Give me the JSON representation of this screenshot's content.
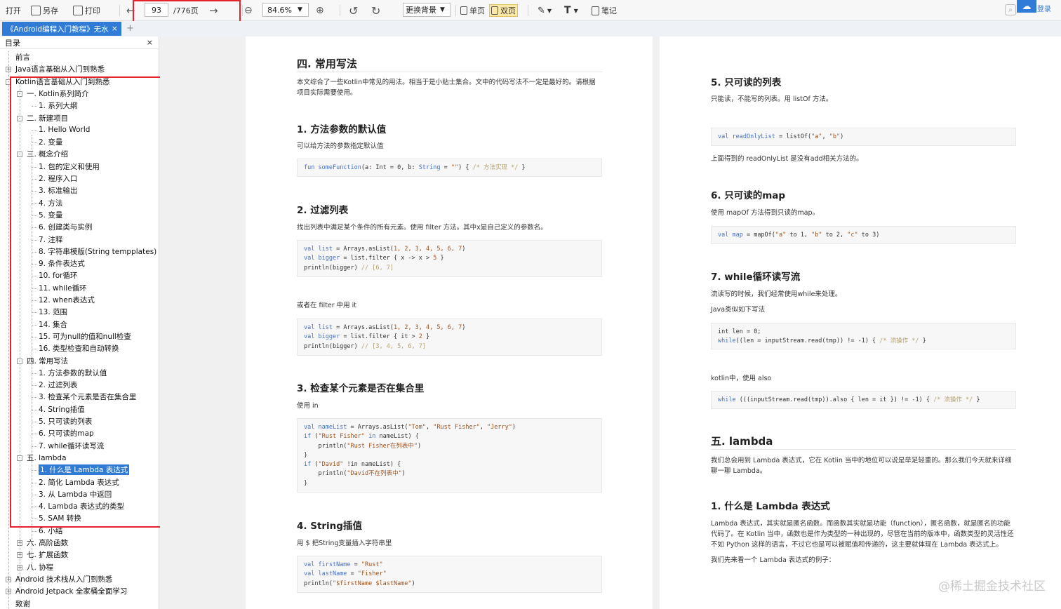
{
  "toolbar": {
    "open": "打开",
    "save_as": "另存",
    "print": "打印",
    "page_current": "93",
    "page_total": "/776页",
    "zoom": "84.6%",
    "bg": "更换背景",
    "single": "单页",
    "double": "双页",
    "notes": "笔记",
    "login": "登录"
  },
  "tab": {
    "title": "《Android编程入门教程》无水",
    "close": "×",
    "add": "+"
  },
  "sidebar": {
    "title": "目录",
    "close": "×",
    "items": [
      "前言",
      "Java语言基础从入门到熟悉",
      "Kotlin语言基础从入门到熟悉",
      "一. Kotlin系列简介",
      "1. 系列大纲",
      "二. 新建项目",
      "1. Hello World",
      "2. 变量",
      "三. 概念介绍",
      "1. 包的定义和使用",
      "2. 程序入口",
      "3. 标准输出",
      "4. 方法",
      "5. 变量",
      "6. 创建类与实例",
      "7. 注释",
      "8. 字符串模版(String tempplates)",
      "9. 条件表达式",
      "10. for循环",
      "11. while循环",
      "12. when表达式",
      "13. 范围",
      "14. 集合",
      "15. 可为null的值和null检查",
      "16. 类型检查和自动转换",
      "四. 常用写法",
      "1. 方法参数的默认值",
      "2. 过滤列表",
      "3. 检查某个元素是否在集合里",
      "4. String插值",
      "5. 只可读的列表",
      "6. 只可读的map",
      "7. while循环读写流",
      "五. lambda",
      "1. 什么是 Lambda 表达式",
      "2. 简化 Lambda 表达式",
      "3. 从 Lambda 中返回",
      "4. Lambda 表达式的类型",
      "5. SAM 转换",
      "6. 小结",
      "六. 高阶函数",
      "七. 扩展函数",
      "八. 协程",
      "Android 技术栈从入门到熟悉",
      "Android Jetpack 全家桶全面学习",
      "致谢"
    ]
  },
  "left_page": {
    "h_section": "四. 常用写法",
    "intro": "本文综合了一些Kotlin中常见的用法。相当于是小贴士集合。文中的代码写法不一定是最好的。请根据项目实际需要使用。",
    "s1_title": "1. 方法参数的默认值",
    "s1_desc": "可以给方法的参数指定默认值",
    "s2_title": "2. 过滤列表",
    "s2_desc": "找出列表中满足某个条件的所有元素。使用 filter 方法。其中x是自己定义的参数名。",
    "s2_or": "或者在 filter 中用 it",
    "s3_title": "3. 检查某个元素是否在集合里",
    "s3_desc": "使用 in",
    "s4_title": "4. String插值",
    "s4_desc": "用 $ 把String变量插入字符串里"
  },
  "right_page": {
    "s5_title": "5. 只可读的列表",
    "s5_desc": "只能读，不能写的列表。用 listOf 方法。",
    "s5_after": "上面得到的 readOnlyList 是没有add相关方法的。",
    "s6_title": "6. 只可读的map",
    "s6_desc": "使用 mapOf 方法得到只读的map。",
    "s7_title": "7. while循环读写流",
    "s7_desc": "流读写的时候，我们经常使用while来处理。",
    "s7_java": "Java类似如下写法",
    "s7_kotlin": "kotlin中，使用 also",
    "h5_title": "五. lambda",
    "h5_desc": "我们总会用到 Lambda 表达式，它在 Kotlin 当中的地位可以说是举足轻重的。那么我们今天就来详细聊一聊 Lambda。",
    "l1_title": "1. 什么是 Lambda 表达式",
    "l1_desc": "Lambda 表达式，其实就是匿名函数。而函数其实就是功能（function），匿名函数，就是匿名的功能代码了。在 Kotlin 当中，函数也是作为类型的一种出现的，尽管在当前的版本中，函数类型的灵活性还不如 Python 这样的语言，不过它也是可以被赋值和传递的，这主要就体现在 Lambda 表达式上。",
    "l1_more": "我们先来看一个 Lambda 表达式的例子："
  },
  "watermark": "@稀土掘金技术社区"
}
